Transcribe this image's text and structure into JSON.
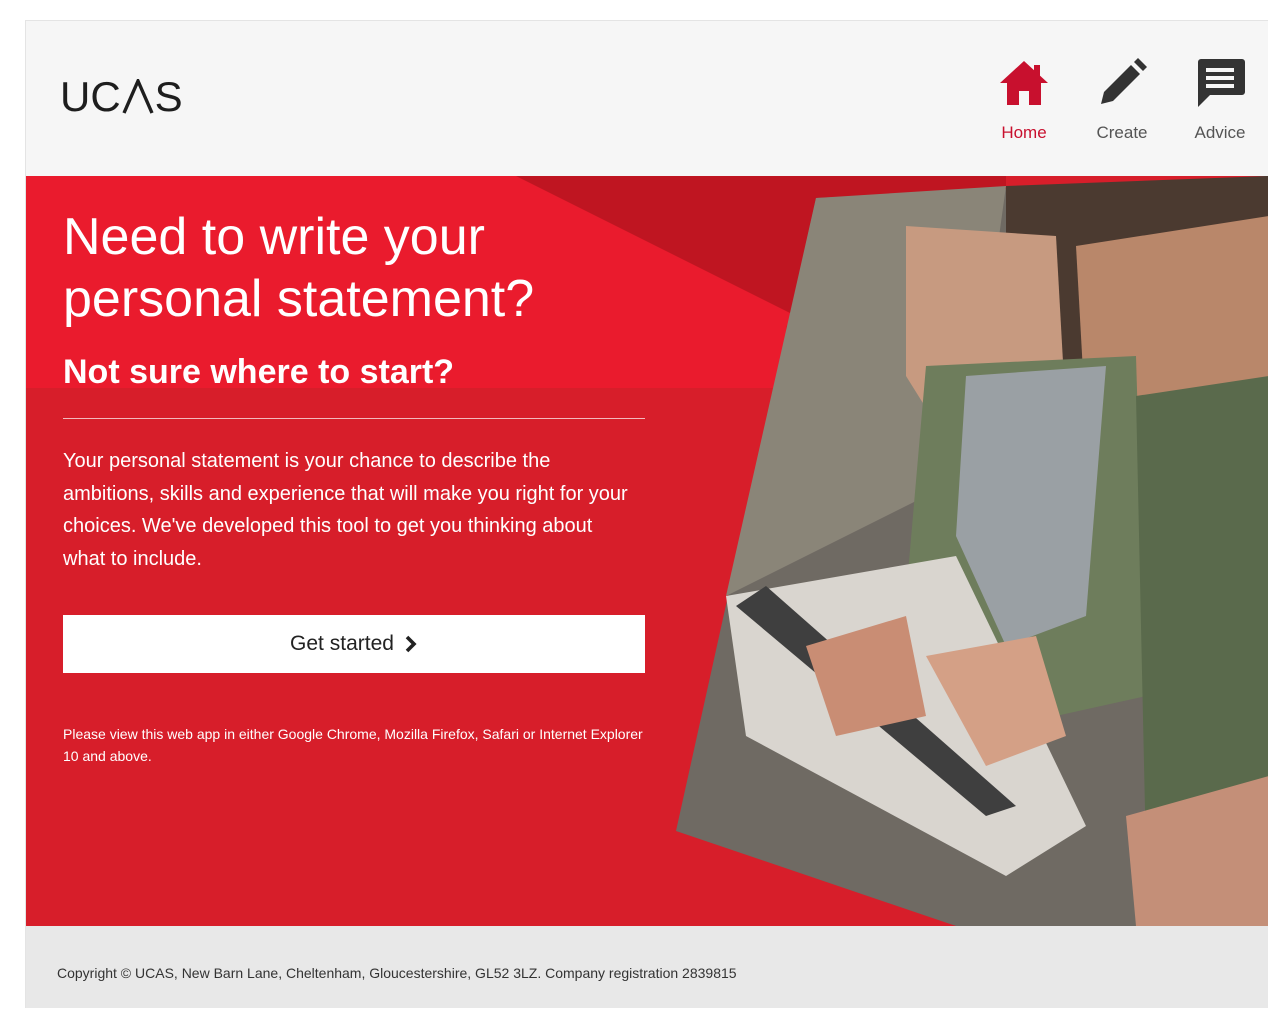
{
  "header": {
    "logo_left": "UC",
    "logo_right": "S",
    "nav": [
      {
        "label": "Home",
        "icon": "home-icon",
        "active": true
      },
      {
        "label": "Create",
        "icon": "pencil-icon",
        "active": false
      },
      {
        "label": "Advice",
        "icon": "speech-bubble-icon",
        "active": false
      }
    ]
  },
  "hero": {
    "headline": "Need to write your personal statement?",
    "subheading": "Not sure where to start?",
    "body": "Your personal statement is your chance to describe the ambitions, skills and experience that will make you right for your choices. We've developed this tool to get you thinking about what to include.",
    "cta_label": "Get started",
    "browser_note": "Please view this web app in either Google Chrome, Mozilla Firefox, Safari or Internet Explorer 10 and above."
  },
  "footer": {
    "copyright": "Copyright © UCAS, New Barn Lane, Cheltenham, Gloucestershire, GL52 3LZ. Company registration 2839815"
  },
  "colors": {
    "brand_red": "#d71e2a",
    "dark_red": "#bf1521",
    "active_nav": "#c8102e"
  }
}
